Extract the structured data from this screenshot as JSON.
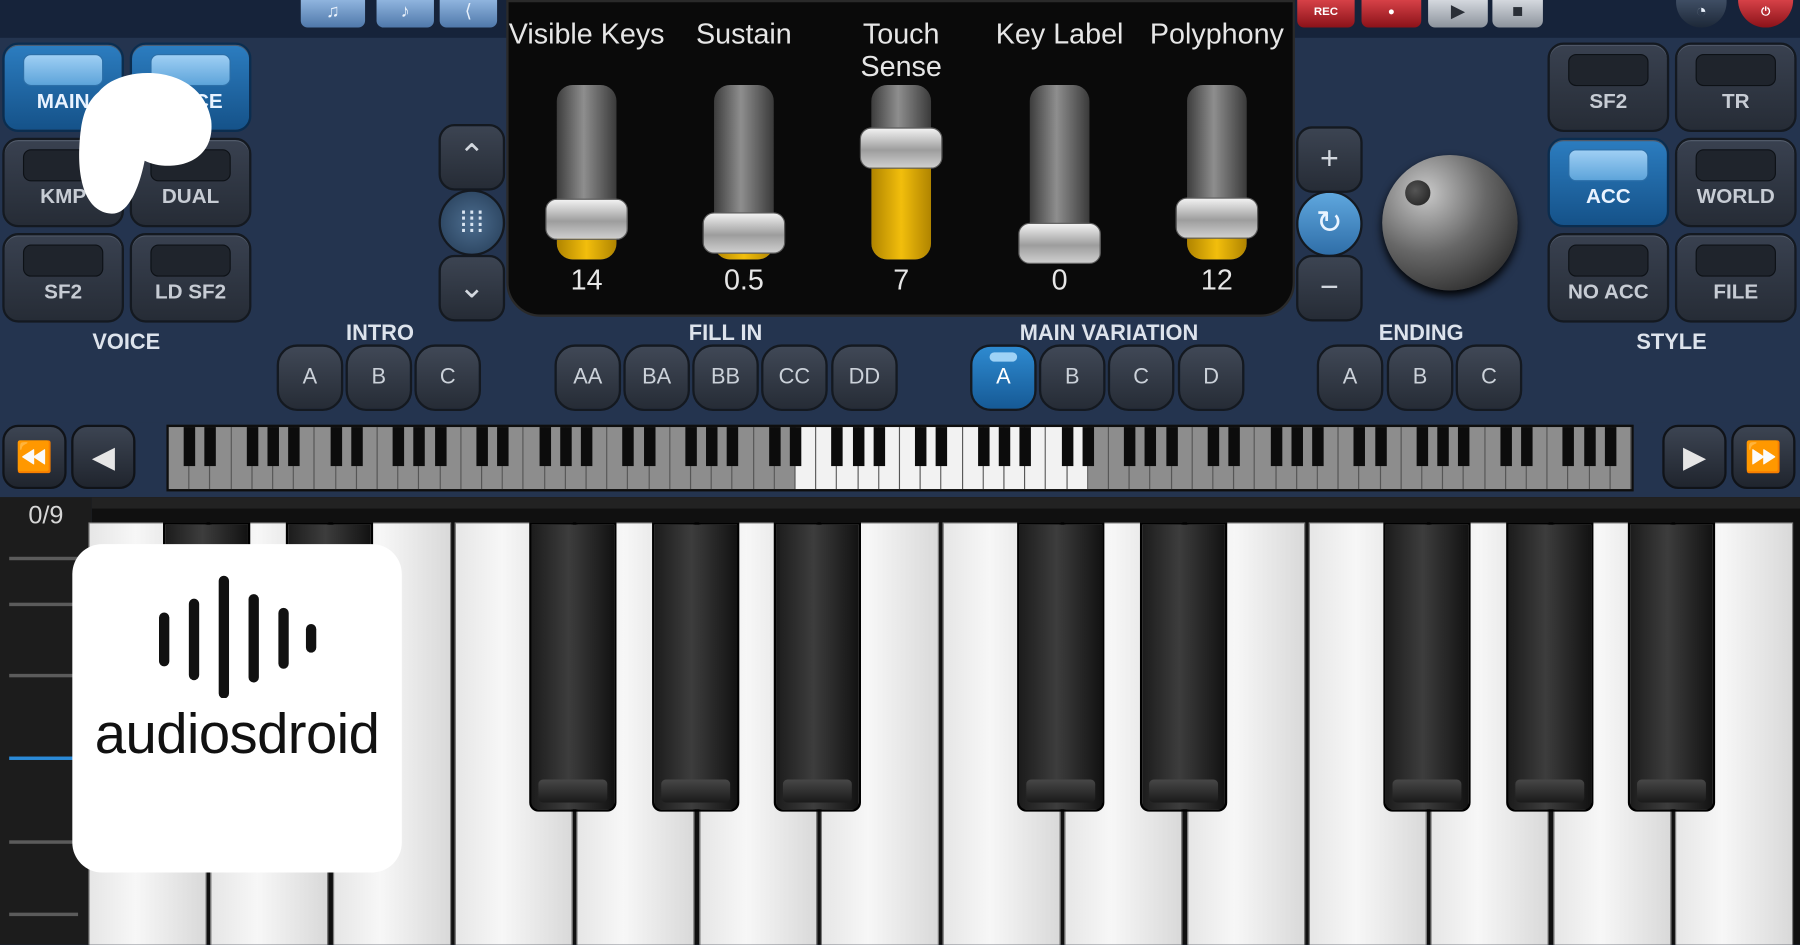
{
  "slider_panel": {
    "sliders": [
      {
        "label": "Visible Keys",
        "value": "14",
        "level": 0.17
      },
      {
        "label": "Sustain",
        "value": "0.5",
        "level": 0.07
      },
      {
        "label": "Touch\nSense",
        "value": "7",
        "level": 0.67
      },
      {
        "label": "Key Label",
        "value": "0",
        "level": 0.0
      },
      {
        "label": "Polyphony",
        "value": "12",
        "level": 0.18
      }
    ],
    "accent_color": "#f2be0c"
  },
  "voice": {
    "title": "VOICE",
    "buttons": [
      "MAIN",
      "VOICE",
      "KMP",
      "DUAL",
      "SF2",
      "LD SF2"
    ],
    "active": "MAIN"
  },
  "style": {
    "title": "STYLE",
    "buttons": [
      "SF2",
      "TR",
      "ACC",
      "WORLD",
      "NO ACC",
      "FILE"
    ],
    "active": "ACC"
  },
  "transport_top": {
    "rec_label": "REC"
  },
  "sections": {
    "intro": {
      "title": "INTRO",
      "buttons": [
        "A",
        "B",
        "C"
      ]
    },
    "fill_in": {
      "title": "FILL IN",
      "buttons": [
        "AA",
        "BA",
        "BB",
        "CC",
        "DD"
      ]
    },
    "main_variation": {
      "title": "MAIN VARIATION",
      "buttons": [
        "A",
        "B",
        "C",
        "D"
      ],
      "active": "A"
    },
    "ending": {
      "title": "ENDING",
      "buttons": [
        "A",
        "B",
        "C"
      ]
    }
  },
  "page_counter": "0/9",
  "badge": {
    "text": "audiosdroid"
  },
  "colors": {
    "background": "#24344f",
    "active_blue": "#2b8ad8"
  }
}
